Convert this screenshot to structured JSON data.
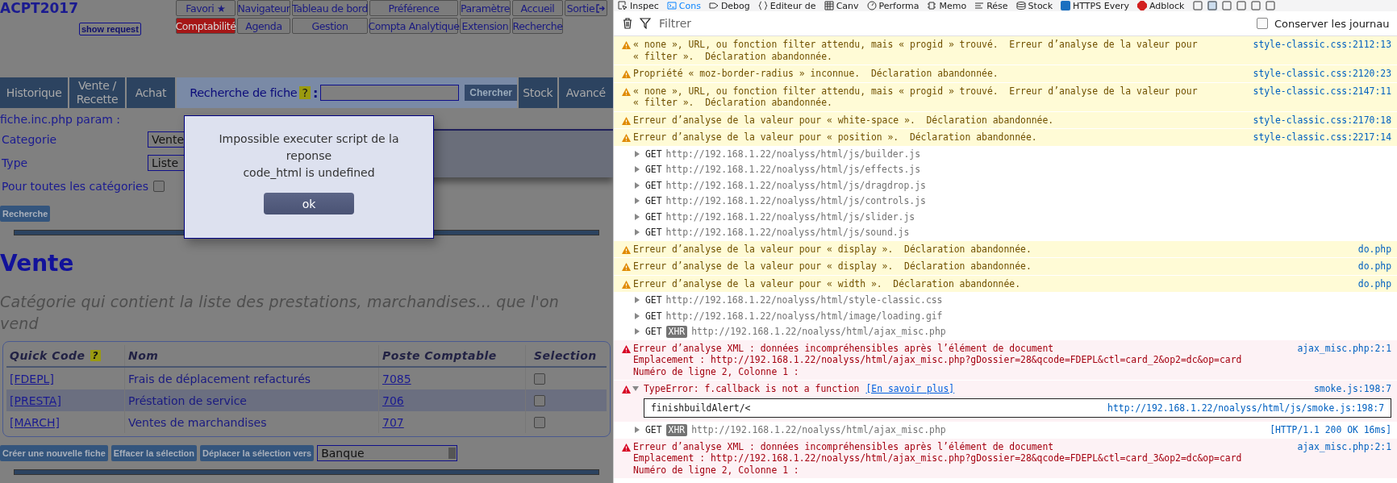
{
  "left_page": {
    "app_title": "ACPT2017",
    "show_request": "show request",
    "menu_rows": [
      [
        {
          "label": "Favori ★",
          "selected": false
        },
        {
          "label": "Navigateur",
          "selected": false
        },
        {
          "label": "Tableau de bord",
          "selected": false
        },
        {
          "label": "Préférence",
          "selected": false
        },
        {
          "label": "Paramètre",
          "selected": false
        },
        {
          "label": "Accueil",
          "selected": false
        },
        {
          "label": "Sortie",
          "selected": false,
          "exit_icon": true
        }
      ],
      [
        {
          "label": "Comptabilité",
          "selected": true
        },
        {
          "label": "Agenda",
          "selected": false
        },
        {
          "label": "Gestion",
          "selected": false
        },
        {
          "label": "Compta Analytique",
          "selected": false
        },
        {
          "label": "Extension",
          "selected": false
        },
        {
          "label": "Recherche",
          "selected": false
        }
      ]
    ],
    "tabs_left": [
      {
        "label": "Historique"
      },
      {
        "label": "Vente / Recette"
      },
      {
        "label": "Achat"
      }
    ],
    "card_search": {
      "label": "Recherche de fiche",
      "help": "?",
      "colon": ":",
      "button": "Chercher"
    },
    "tabs_right": [
      {
        "label": "Stock"
      },
      {
        "label": "Avancé"
      }
    ],
    "param_title": "fiche.inc.php param :",
    "form": {
      "category": {
        "label": "Categorie",
        "value": "Vente"
      },
      "type": {
        "label": "Type",
        "value": "Liste"
      },
      "all_categories": {
        "label": "Pour toutes les catégories",
        "checked": false
      },
      "search_button": "Recherche"
    },
    "heading": "Vente",
    "description": "Catégorie qui contient la liste des prestations, marchandises... que l'on vend",
    "table": {
      "columns": [
        "Quick Code",
        "Nom",
        "Poste Comptable",
        "Selection"
      ],
      "help": "?",
      "rows": [
        {
          "code": "[FDEPL]",
          "name": "Frais de déplacement refacturés",
          "account": "7085",
          "checked": false
        },
        {
          "code": "[PRESTA]",
          "name": "Préstation de service",
          "account": "706",
          "checked": false
        },
        {
          "code": "[MARCH]",
          "name": "Ventes de marchandises",
          "account": "707",
          "checked": false
        }
      ]
    },
    "actions": [
      "Créer une nouvelle fiche",
      "Effacer la sélection",
      "Déplacer la sélection vers"
    ],
    "target": {
      "value": "Banque"
    }
  },
  "dialog": {
    "lines": [
      "Impossible executer script de la reponse",
      "code_html is undefined"
    ],
    "button": "ok"
  },
  "devtools": {
    "tabs": [
      {
        "label": "Inspec",
        "selected": false
      },
      {
        "label": "Cons",
        "selected": true
      },
      {
        "label": "Debog",
        "selected": false
      },
      {
        "label": "Editeur de",
        "selected": false
      },
      {
        "label": "Canv",
        "selected": false
      },
      {
        "label": "Performa",
        "selected": false
      },
      {
        "label": "Memo",
        "selected": false
      },
      {
        "label": "Rése",
        "selected": false
      },
      {
        "label": "Stock",
        "selected": false
      },
      {
        "label": "HTTPS Every",
        "selected": false
      },
      {
        "label": "Adblock",
        "selected": false
      }
    ],
    "filter": {
      "placeholder": "Filtrer"
    },
    "persist": {
      "label": "Conserver les journau",
      "checked": false
    },
    "messages": [
      {
        "kind": "warning",
        "lines": [
          "« none », URL, ou fonction filter attendu, mais « progid » trouvé.  Erreur d’analyse de la valeur pour",
          "« filter ».  Déclaration abandonnée."
        ],
        "source": "style-classic.css:2112:13"
      },
      {
        "kind": "warning",
        "lines": [
          "Propriété « moz-border-radius » inconnue.  Déclaration abandonnée."
        ],
        "source": "style-classic.css:2120:23"
      },
      {
        "kind": "warning",
        "lines": [
          "« none », URL, ou fonction filter attendu, mais « progid » trouvé.  Erreur d’analyse de la valeur pour",
          "« filter ».  Déclaration abandonnée."
        ],
        "source": "style-classic.css:2147:11"
      },
      {
        "kind": "warning",
        "lines": [
          "Erreur d’analyse de la valeur pour « white-space ».  Déclaration abandonnée."
        ],
        "source": "style-classic.css:2170:18"
      },
      {
        "kind": "warning",
        "lines": [
          "Erreur d’analyse de la valeur pour « position ».  Déclaration abandonnée."
        ],
        "source": "style-classic.css:2217:14"
      },
      {
        "kind": "request",
        "method": "GET",
        "url": "http://192.168.1.22/noalyss/html/js/builder.js",
        "expanded": false
      },
      {
        "kind": "request",
        "method": "GET",
        "url": "http://192.168.1.22/noalyss/html/js/effects.js",
        "expanded": false
      },
      {
        "kind": "request",
        "method": "GET",
        "url": "http://192.168.1.22/noalyss/html/js/dragdrop.js",
        "expanded": false
      },
      {
        "kind": "request",
        "method": "GET",
        "url": "http://192.168.1.22/noalyss/html/js/controls.js",
        "expanded": false
      },
      {
        "kind": "request",
        "method": "GET",
        "url": "http://192.168.1.22/noalyss/html/js/slider.js",
        "expanded": false
      },
      {
        "kind": "request",
        "method": "GET",
        "url": "http://192.168.1.22/noalyss/html/js/sound.js",
        "expanded": false
      },
      {
        "kind": "warning",
        "lines": [
          "Erreur d’analyse de la valeur pour « display ».  Déclaration abandonnée."
        ],
        "source": "do.php"
      },
      {
        "kind": "warning",
        "lines": [
          "Erreur d’analyse de la valeur pour « display ».  Déclaration abandonnée."
        ],
        "source": "do.php"
      },
      {
        "kind": "warning",
        "lines": [
          "Erreur d’analyse de la valeur pour « width ».  Déclaration abandonnée."
        ],
        "source": "do.php"
      },
      {
        "kind": "request",
        "method": "GET",
        "url": "http://192.168.1.22/noalyss/html/style-classic.css",
        "expanded": false
      },
      {
        "kind": "request",
        "method": "GET",
        "url": "http://192.168.1.22/noalyss/html/image/loading.gif",
        "expanded": false
      },
      {
        "kind": "request",
        "method": "GET",
        "badge": "XHR",
        "url": "http://192.168.1.22/noalyss/html/ajax_misc.php",
        "expanded": false
      },
      {
        "kind": "error",
        "lines": [
          "Erreur d’analyse XML : données incompréhensibles après l’élément de document",
          "Emplacement : http://192.168.1.22/noalyss/html/ajax_misc.php?gDossier=28&qcode=FDEPL&ctl=card_2&op2=dc&op=card",
          "Numéro de ligne 2, Colonne 1 :"
        ],
        "source": "ajax_misc.php:2:1"
      },
      {
        "kind": "error",
        "lines": [
          "TypeError: f.callback is not a function"
        ],
        "link": "[En savoir plus]",
        "expanded": true,
        "stack": {
          "function": "finishbuildAlert/<",
          "source": "http://192.168.1.22/noalyss/html/js/smoke.js:198:7"
        },
        "source": "smoke.js:198:7"
      },
      {
        "kind": "request",
        "method": "GET",
        "badge": "XHR",
        "url": "http://192.168.1.22/noalyss/html/ajax_misc.php",
        "expanded": false,
        "status": "[HTTP/1.1 200 OK 16ms]"
      },
      {
        "kind": "error",
        "lines": [
          "Erreur d’analyse XML : données incompréhensibles après l’élément de document",
          "Emplacement : http://192.168.1.22/noalyss/html/ajax_misc.php?gDossier=28&qcode=FDEPL&ctl=card_3&op2=dc&op=card",
          "Numéro de ligne 2, Colonne 1 :"
        ],
        "source": "ajax_misc.php:2:1"
      }
    ]
  }
}
